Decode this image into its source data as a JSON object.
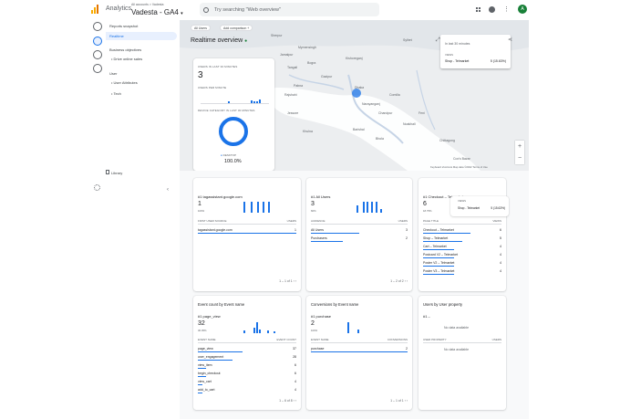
{
  "header": {
    "brand": "Analytics",
    "breadcrumb": "All accounts > Vadesta",
    "property": "Vadesta - GA4",
    "search_placeholder": "Try searching \"Web overview\"",
    "avatar_letter": "A"
  },
  "sidebar": {
    "reports_snapshot": "Reports snapshot",
    "realtime": "Realtime",
    "business_objectives": "Business objectives",
    "drive_online_sales": "Drive online sales",
    "user": "User",
    "user_attributes": "User Attributes",
    "tech": "Tech",
    "library": "Library",
    "collapse": "‹"
  },
  "map": {
    "title": "Realtime overview",
    "chip_all_users": "All Users",
    "chip_add_comparison": "Add comparison +",
    "popup_time": "In last 30 minutes",
    "popup_metric": "VIEWS",
    "popup_row_label": "Shop - Telmarket",
    "popup_row_value": "5 (15.63%)",
    "attribution": "Keyboard shortcuts  Map data ©2022  Terms of Use",
    "zoom_in": "+",
    "zoom_out": "−",
    "places": [
      "Sherpur",
      "Mymensingh",
      "Jamalpur",
      "Sylhet",
      "Tangail",
      "Kishoreganj",
      "Gazipur",
      "Dhaka",
      "Narayanganj",
      "Comilla",
      "Chandpur",
      "Feni",
      "Noakhali",
      "Barishal",
      "Bhola",
      "Khulna",
      "Jessore",
      "Chittagong",
      "Cox's Bazar",
      "Rajshahi",
      "Pabna",
      "Bogra"
    ]
  },
  "realtime_card": {
    "users_label": "USERS IN LAST 30 MINUTES",
    "users_value": "3",
    "per_minute_label": "USERS PER MINUTE",
    "device_label": "DEVICE CATEGORY IN LAST 30 MINUTES",
    "legend_label": "DESKTOP",
    "legend_value": "100.0%"
  },
  "cards": {
    "source": {
      "metric": "#1 tagassistant.google.com",
      "value": "1",
      "percent": "100%",
      "col1": "FIRST USER SOURCE",
      "col2": "USERS",
      "rows": [
        {
          "name": "tagassistant.google.com",
          "value": "1"
        }
      ],
      "pager": "1 – 1 of 1"
    },
    "audience": {
      "metric": "#1 All Users",
      "value": "3",
      "percent": "60%",
      "col1": "AUDIENCE",
      "col2": "USERS",
      "rows": [
        {
          "name": "All Users",
          "value": "3"
        },
        {
          "name": "Purchasers",
          "value": "2"
        }
      ],
      "pager": "1 – 2 of 2"
    },
    "pages": {
      "metric": "#1 Checkout – Telmarket",
      "value": "6",
      "percent": "18.75%",
      "col1": "PAGE TITLE",
      "col2": "VIEWS",
      "tooltip_metric": "VIEWS",
      "tooltip_label": "Shop - Telmarket",
      "tooltip_value": "5 (15.63%)",
      "rows": [
        {
          "name": "Checkout – Telmarket",
          "value": "6"
        },
        {
          "name": "Shop – Telmarket",
          "value": "5"
        },
        {
          "name": "Cart – Telmarket",
          "value": "4"
        },
        {
          "name": "Postcard V2 – Telmarket",
          "value": "4"
        },
        {
          "name": "Poster V2 – Telmarket",
          "value": "4"
        },
        {
          "name": "Poster V3 – Telmarket",
          "value": "4"
        }
      ]
    },
    "events": {
      "title": "Event count by Event name",
      "metric": "#1 page_view",
      "value": "32",
      "percent": "36.05%",
      "col1": "EVENT NAME",
      "col2": "EVENT COUNT",
      "rows": [
        {
          "name": "page_view",
          "value": "37"
        },
        {
          "name": "user_engagement",
          "value": "28"
        },
        {
          "name": "view_item",
          "value": "6"
        },
        {
          "name": "begin_checkout",
          "value": "6"
        },
        {
          "name": "view_cart",
          "value": "4"
        },
        {
          "name": "add_to_cart",
          "value": "4"
        }
      ],
      "pager": "1 – 6 of 8"
    },
    "conversions": {
      "title": "Conversions by Event name",
      "metric": "#1 purchase",
      "value": "2",
      "percent": "100%",
      "col1": "EVENT NAME",
      "col2": "CONVERSIONS",
      "rows": [
        {
          "name": "purchase",
          "value": "2"
        }
      ],
      "pager": "1 – 1 of 1"
    },
    "user_property": {
      "title": "Users by User property",
      "metric": "#1 –",
      "nodata1": "No data available",
      "col1": "USER PROPERTY",
      "col2": "USERS",
      "nodata2": "No data available"
    }
  }
}
